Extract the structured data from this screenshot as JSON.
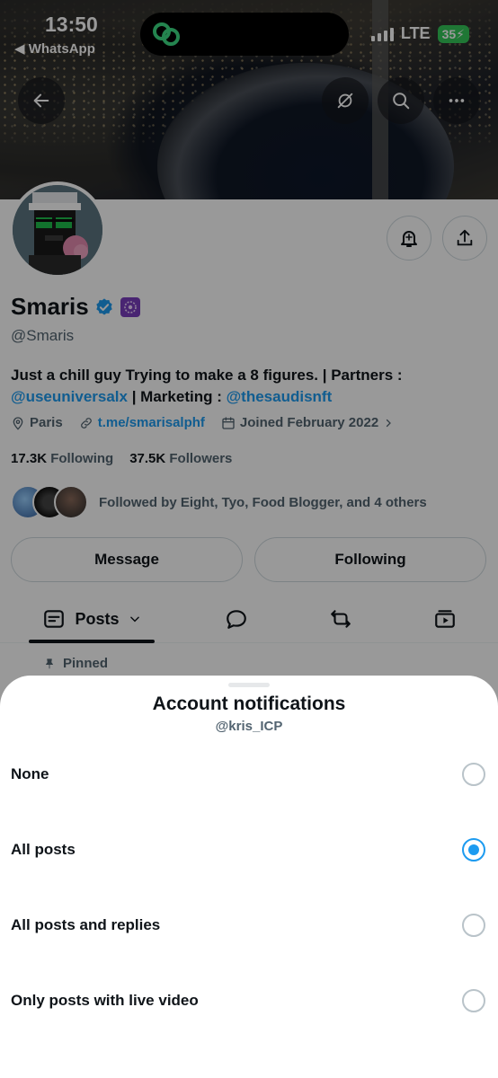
{
  "status_bar": {
    "time": "13:50",
    "back_app": "◀ WhatsApp",
    "network": "LTE",
    "battery": "35"
  },
  "profile": {
    "name": "Smaris",
    "handle": "@Smaris",
    "bio_text_1": "Just a chill guy Trying to make a 8 figures. | Partners :",
    "bio_link_1": "@useuniversalx",
    "bio_text_2": " | Marketing : ",
    "bio_link_2": "@thesaudisnft",
    "location": "Paris",
    "website": "t.me/smarisalphf",
    "joined": "Joined February 2022",
    "following_count": "17.3K",
    "following_label": "Following",
    "followers_count": "37.5K",
    "followers_label": "Followers",
    "followed_by": "Followed by Eight, Tyo, Food Blogger, and 4 others",
    "message_button": "Message",
    "following_button": "Following",
    "pinned_label": "Pinned",
    "verified_color": "#1d9bf0",
    "affiliate_badge_color": "#7b3fbf"
  },
  "tabs": [
    {
      "label": "Posts",
      "icon": "posts-icon",
      "active": true
    },
    {
      "label": "",
      "icon": "replies-icon",
      "active": false
    },
    {
      "label": "",
      "icon": "repost-icon",
      "active": false
    },
    {
      "label": "",
      "icon": "media-icon",
      "active": false
    }
  ],
  "sheet": {
    "title": "Account notifications",
    "subtitle": "@kris_ICP",
    "options": [
      {
        "label": "None",
        "selected": false
      },
      {
        "label": "All posts",
        "selected": true
      },
      {
        "label": "All posts and replies",
        "selected": false
      },
      {
        "label": "Only posts with live video",
        "selected": false
      }
    ]
  }
}
